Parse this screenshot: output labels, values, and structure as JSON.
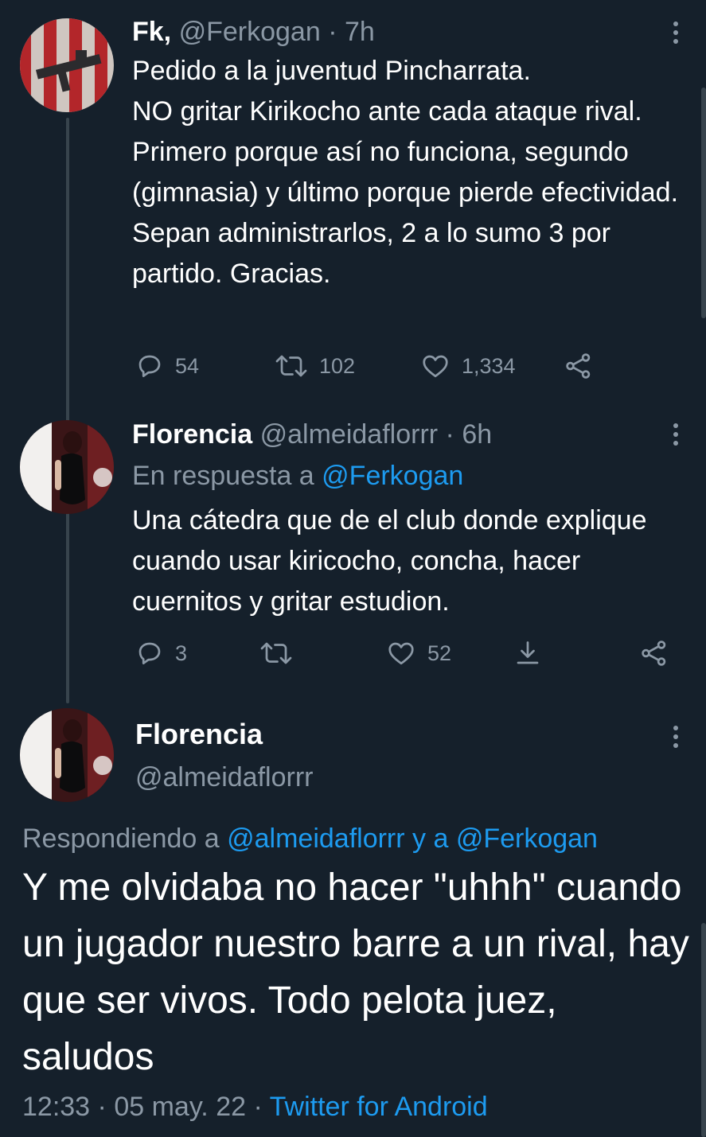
{
  "tweet1": {
    "name": "Fk,",
    "handle": "@Ferkogan",
    "time": "· 7h",
    "text": "Pedido a la juventud Pincharrata.\nNO gritar Kirikocho ante cada ataque rival. Primero porque así no funciona, segundo (gimnasia) y último porque pierde efectividad.\nSepan administrarlos, 2 a lo sumo 3 por partido. Gracias.",
    "replies": "54",
    "retweets": "102",
    "likes": "1,334",
    "icons": [
      "reply-icon",
      "retweet-icon",
      "like-icon",
      "share-icon"
    ]
  },
  "tweet2": {
    "name": "Florencia",
    "handle": "@almeidaflorrr",
    "time": "· 6h",
    "reply_prefix": "En respuesta a",
    "reply_to": "@Ferkogan",
    "text": "Una cátedra que de el club donde explique cuando usar kiricocho, concha, hacer cuernitos y gritar estudion.",
    "replies": "3",
    "retweets": "",
    "likes": "52",
    "icons": [
      "reply-icon",
      "retweet-icon",
      "like-icon",
      "download-icon",
      "share-icon"
    ]
  },
  "tweet3": {
    "name": "Florencia",
    "handle": "@almeidaflorrr",
    "reply_prefix": "Respondiendo a",
    "reply_to": "@almeidaflorrr y a @Ferkogan",
    "text": "Y me olvidaba no hacer \"uhhh\" cuando un jugador nuestro barre a un rival, hay que ser vivos. Todo pelota juez, saludos",
    "time": "12:33",
    "date": "05 may. 22",
    "source": "Twitter for Android"
  },
  "colors": {
    "background": "#15202b",
    "text": "#ffffff",
    "muted": "#8b98a5",
    "link": "#1d9bf0"
  }
}
